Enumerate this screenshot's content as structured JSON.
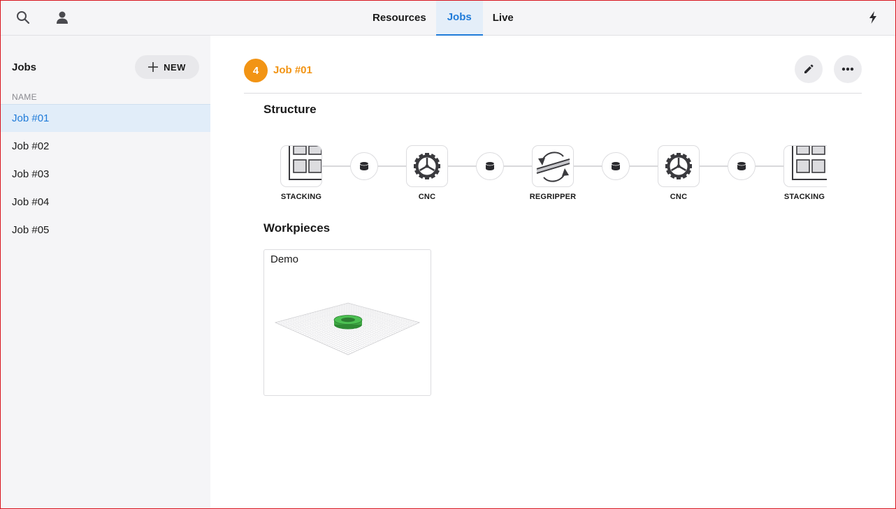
{
  "topbar": {
    "tabs": [
      {
        "label": "Resources"
      },
      {
        "label": "Jobs"
      },
      {
        "label": "Live"
      }
    ],
    "icons": {
      "left": [
        "search-icon",
        "user-icon"
      ],
      "right": "bolt-icon"
    }
  },
  "sidebar": {
    "title": "Jobs",
    "new_label": "NEW",
    "column_header": "NAME",
    "jobs": [
      {
        "label": "Job #01",
        "selected": true
      },
      {
        "label": "Job #02"
      },
      {
        "label": "Job #03"
      },
      {
        "label": "Job #04"
      },
      {
        "label": "Job #05"
      }
    ]
  },
  "job": {
    "badge": "4",
    "title": "Job #01",
    "actions": [
      "edit-icon",
      "more-icon"
    ]
  },
  "structure": {
    "title": "Structure",
    "nodes": [
      {
        "label": "STACKING",
        "icon": "stacking-icon"
      },
      {
        "label": "CNC",
        "icon": "gear-icon"
      },
      {
        "label": "REGRIPPER",
        "icon": "regripper-icon"
      },
      {
        "label": "CNC",
        "icon": "gear-icon"
      },
      {
        "label": "STACKING",
        "icon": "stacking-icon"
      }
    ],
    "buffer_icon": "buffer-icon"
  },
  "workpieces": {
    "title": "Workpieces",
    "items": [
      {
        "name": "Demo",
        "preview_icon": "workpiece-ring-icon"
      }
    ]
  },
  "colors": {
    "accent": "#1f7bd9",
    "job_badge": "#f29414",
    "workpiece": "#3ea843",
    "frame": "#d8141e"
  }
}
